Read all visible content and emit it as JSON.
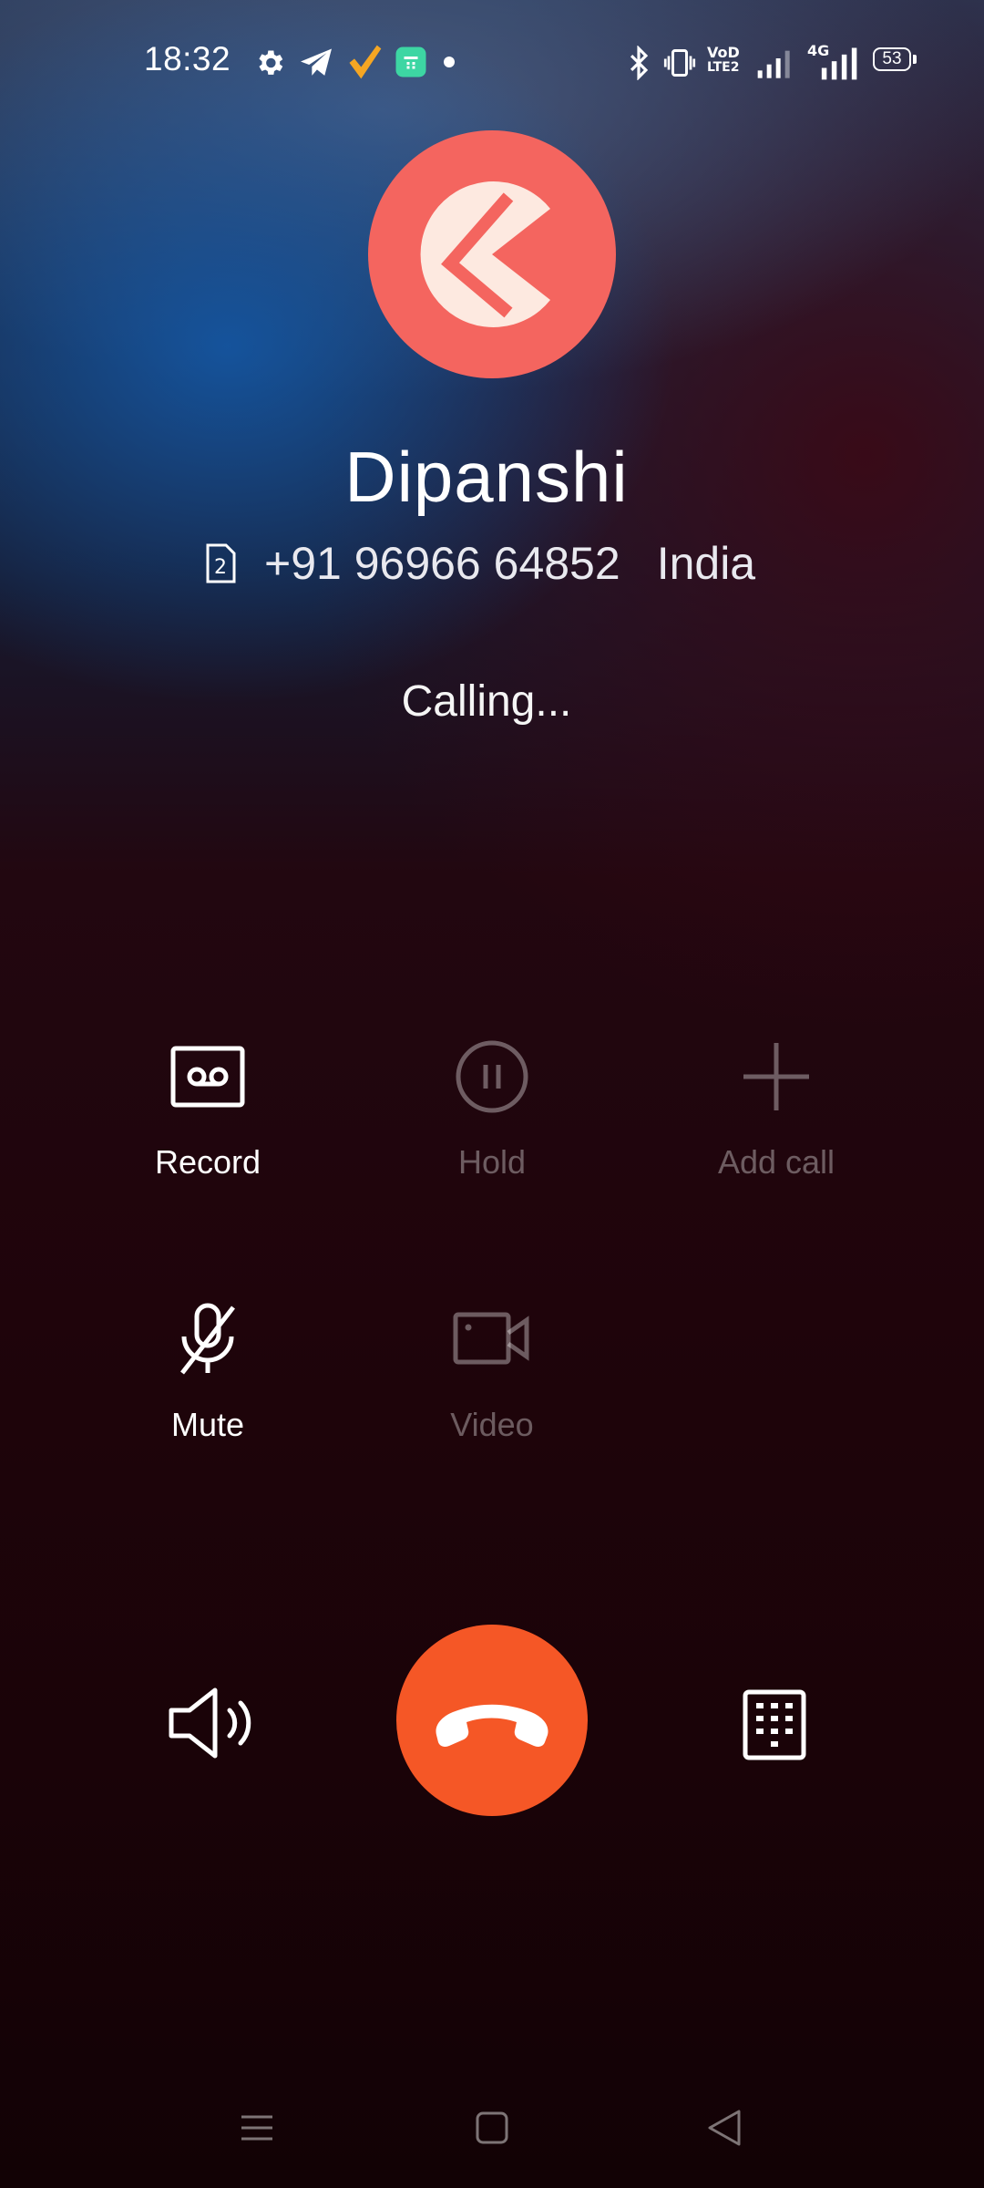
{
  "status_bar": {
    "time": "18:32",
    "icons": [
      "settings-icon",
      "telegram-icon",
      "check-app-icon",
      "android-app-icon",
      "notification-dot-icon",
      "bluetooth-icon",
      "vibrate-icon",
      "volte-icon",
      "signal-icon",
      "4g-signal-icon",
      "battery-icon"
    ],
    "volte_top": "VoD",
    "volte_bottom": "LTE2",
    "network": "4G",
    "battery": "53"
  },
  "caller": {
    "name": "Dipanshi",
    "sim_slot": "2",
    "number": "+91 96966 64852",
    "country": "India",
    "status": "Calling...",
    "avatar_color": "#f4655f"
  },
  "actions": {
    "record": "Record",
    "hold": "Hold",
    "add_call": "Add call",
    "mute": "Mute",
    "video": "Video"
  },
  "controls": {
    "end_call_color": "#f55726",
    "icons": [
      "speaker-icon",
      "end-call-icon",
      "dialpad-icon"
    ]
  },
  "nav": {
    "icons": [
      "menu-icon",
      "home-icon",
      "back-icon"
    ]
  }
}
